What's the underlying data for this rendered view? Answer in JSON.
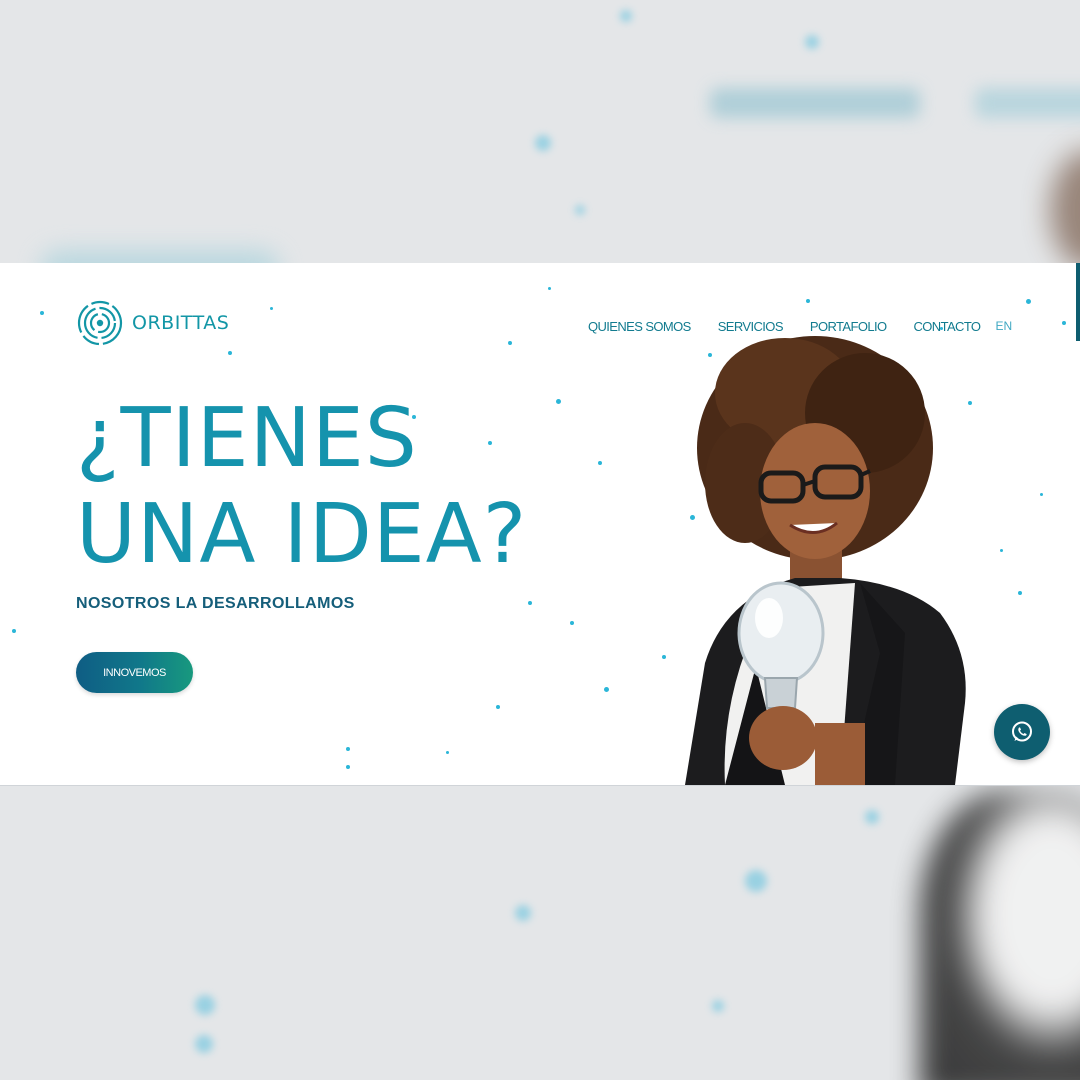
{
  "brand": {
    "name": "ORBITTAS"
  },
  "nav": {
    "items": [
      {
        "label": "QUIENES SOMOS"
      },
      {
        "label": "SERVICIOS"
      },
      {
        "label": "PORTAFOLIO"
      },
      {
        "label": "CONTACTO"
      }
    ],
    "language": "EN"
  },
  "hero": {
    "title_line1": "¿TIENES",
    "title_line2": "UNA IDEA?",
    "subtitle": "NOSOTROS LA DESARROLLAMOS",
    "cta_label": "INNOVEMOS"
  },
  "icons": {
    "logo": "orbit-logo-icon",
    "chat": "whatsapp-icon"
  },
  "colors": {
    "primary": "#1593ad",
    "dark_teal": "#0e5e70",
    "subtitle": "#155e7a",
    "accent_dots": "#2bb6d8",
    "backdrop": "#e4e6e8"
  }
}
